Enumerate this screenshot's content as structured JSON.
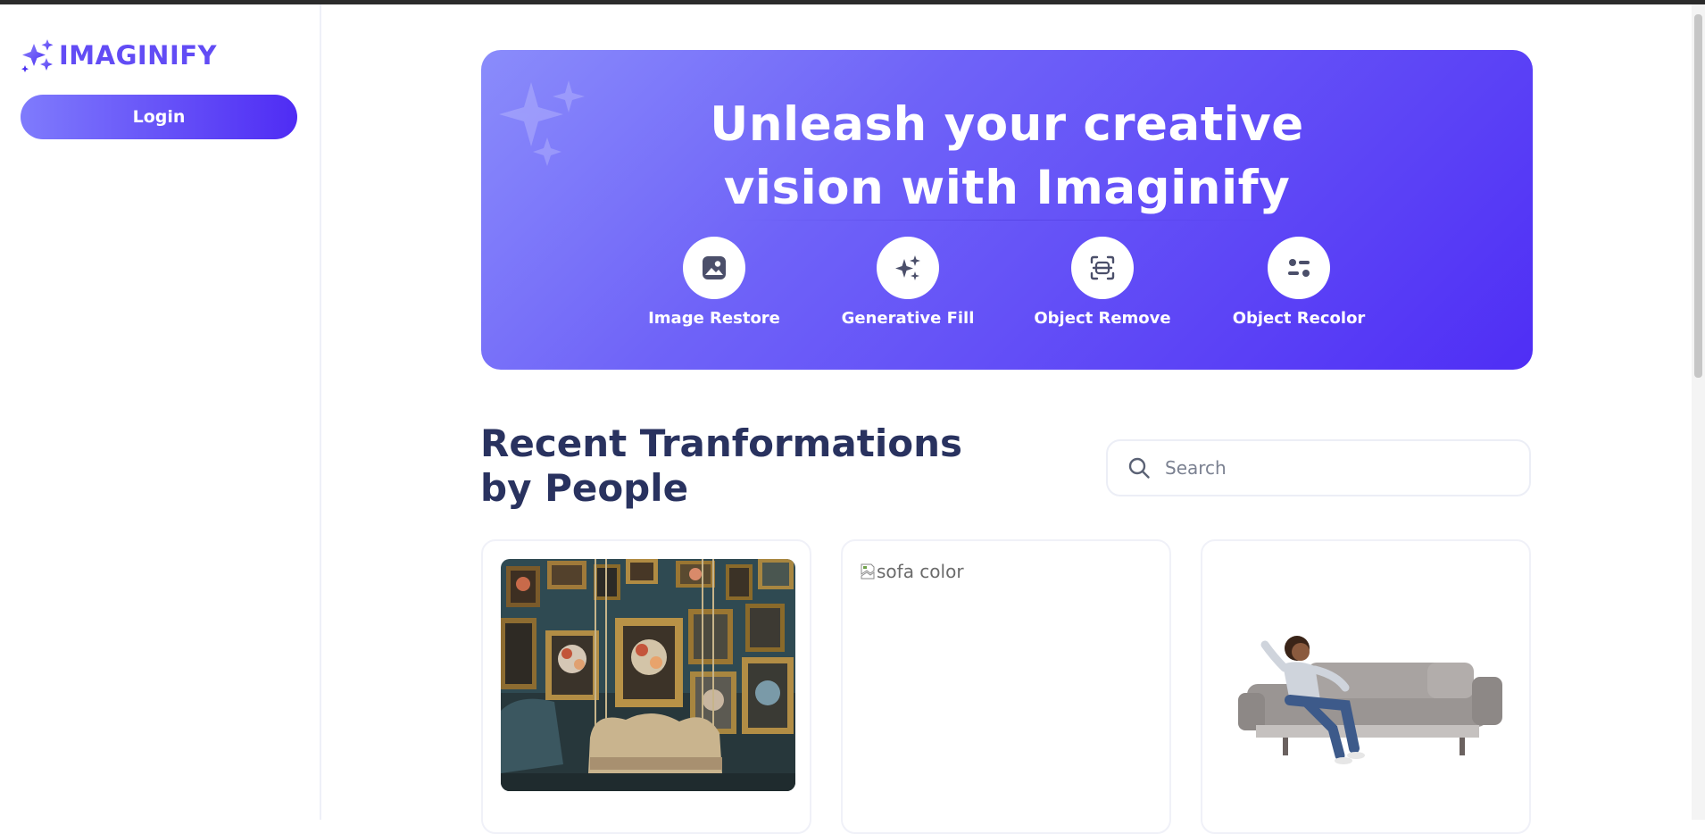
{
  "app": {
    "logo_text": "IMAGINIFY",
    "logo_icon": "sparkles-logo-icon",
    "brand_color": "#624cf5"
  },
  "sidebar": {
    "login_label": "Login"
  },
  "hero": {
    "title_line1": "Unleash your creative",
    "title_line2": "vision with Imaginify",
    "tools": [
      {
        "label": "Image Restore",
        "icon": "image-icon"
      },
      {
        "label": "Generative Fill",
        "icon": "stars-icon"
      },
      {
        "label": "Object Remove",
        "icon": "scan-icon"
      },
      {
        "label": "Object Recolor",
        "icon": "filter-icon"
      }
    ]
  },
  "recent": {
    "title": "Recent Tranformations by People",
    "search": {
      "placeholder": "Search",
      "value": ""
    },
    "cards": [
      {
        "image": "vintage room with framed paintings and sofa"
      },
      {
        "image_alt": "sofa color"
      },
      {
        "image": "woman sitting on grey sofa"
      }
    ]
  }
}
